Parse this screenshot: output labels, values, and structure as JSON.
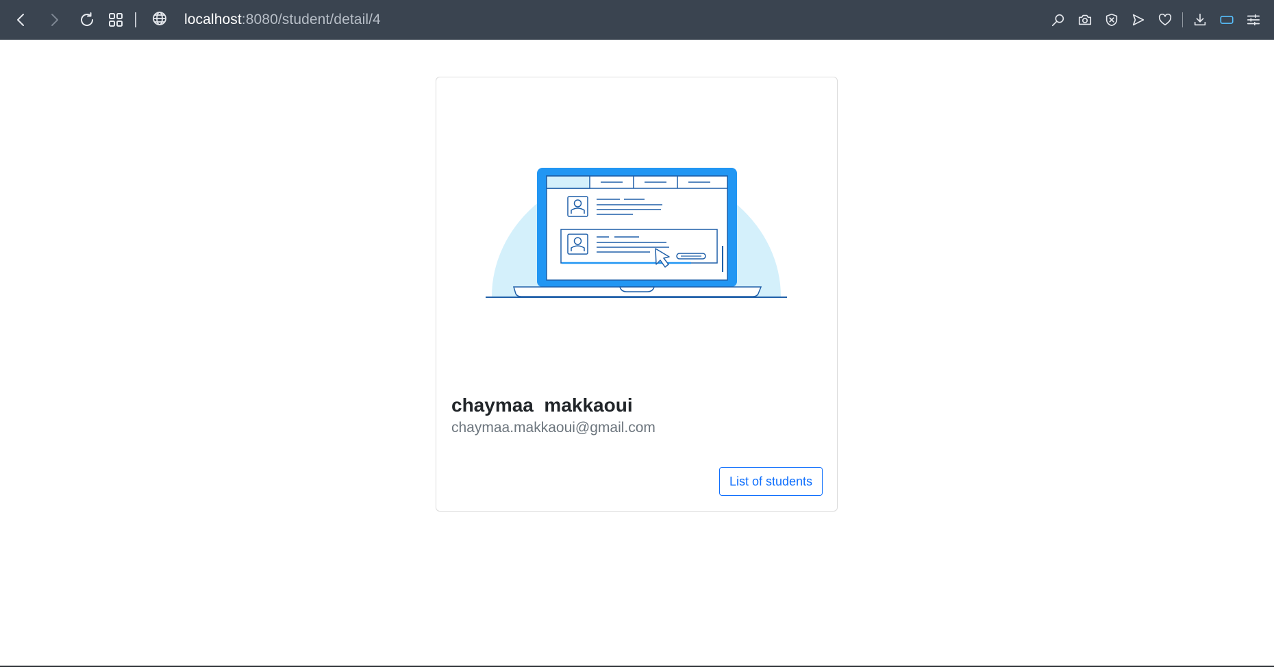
{
  "browser": {
    "url_host": "localhost",
    "url_path": ":8080/student/detail/4",
    "icons": [
      "back-arrow-icon",
      "forward-arrow-icon",
      "reload-icon",
      "tabs-grid-icon",
      "globe-icon",
      "search-icon",
      "camera-icon",
      "shield-icon",
      "send-icon",
      "heart-icon",
      "download-icon",
      "window-icon",
      "settings-icon"
    ],
    "toolbar_color": "#3a4450",
    "accent_color": "#58c1ff"
  },
  "student": {
    "first_name": "chaymaa",
    "last_name": "makkaoui",
    "full_name": "chaymaa  makkaoui",
    "email": "chaymaa.makkaoui@gmail.com"
  },
  "actions": {
    "list_button_label": "List of students",
    "button_color": "#0d6efd"
  }
}
